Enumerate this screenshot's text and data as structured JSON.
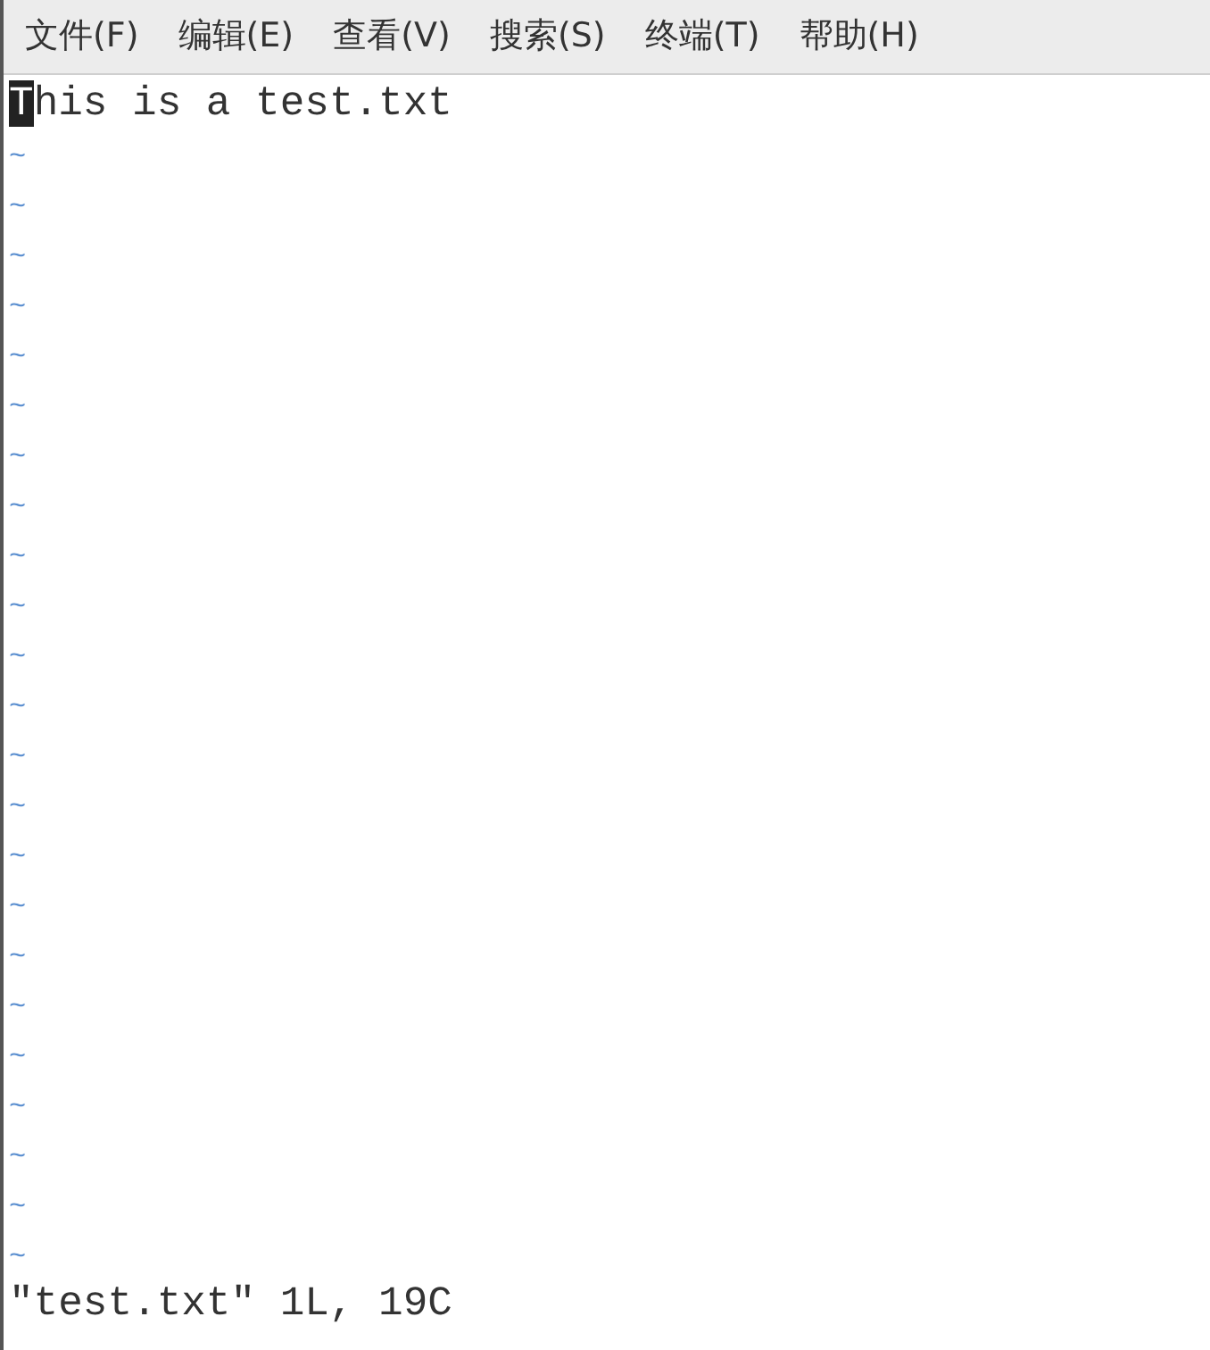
{
  "menu": [
    {
      "label": "文件(F)"
    },
    {
      "label": "编辑(E)"
    },
    {
      "label": "查看(V)"
    },
    {
      "label": "搜索(S)"
    },
    {
      "label": "终端(T)"
    },
    {
      "label": "帮助(H)"
    }
  ],
  "buffer_lines": [
    {
      "cursor_text": "T",
      "text": "his is a test.txt"
    }
  ],
  "empty_line_markers": [
    "~",
    "~",
    "~",
    "~",
    "~",
    "~",
    "~",
    "~",
    "~",
    "~",
    "~",
    "~",
    "~",
    "~",
    "~",
    "~",
    "~",
    "~",
    "~",
    "~",
    "~",
    "~",
    "~"
  ],
  "status_line": "\"test.txt\" 1L, 19C"
}
